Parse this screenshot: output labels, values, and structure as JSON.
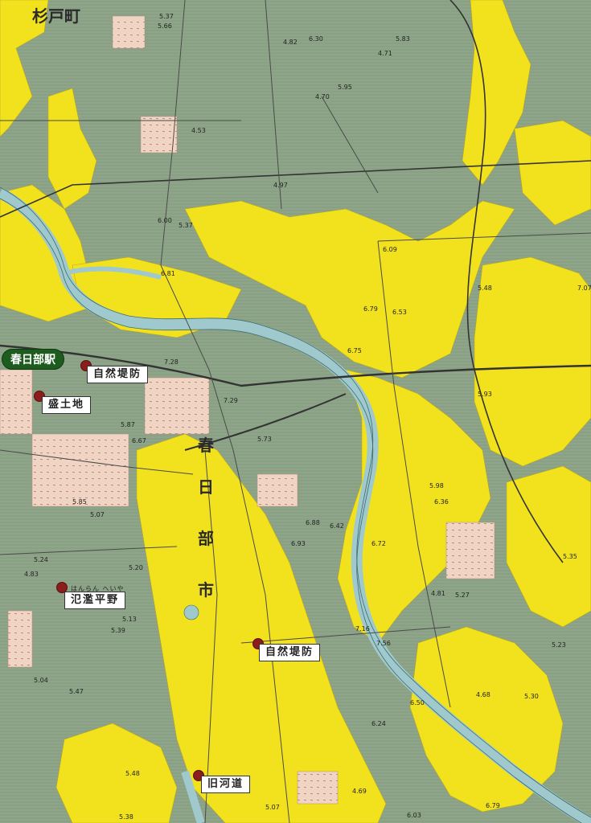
{
  "map": {
    "station": {
      "name": "春日部駅"
    },
    "town_label": "杉戸町",
    "city_label": [
      "春",
      "日",
      "部",
      "市"
    ],
    "annotations": [
      {
        "id": "natural-levee-1",
        "label": "自然堤防"
      },
      {
        "id": "fill-land",
        "label": "盛土地"
      },
      {
        "id": "flood-plain",
        "label": "氾濫平野",
        "reading": "はんらん へいや"
      },
      {
        "id": "natural-levee-2",
        "label": "自然堤防"
      },
      {
        "id": "old-river",
        "label": "旧河道"
      }
    ],
    "elevations": [
      "5.37",
      "5.66",
      "4.82",
      "6.30",
      "5.83",
      "4.71",
      "5.95",
      "4.70",
      "4.53",
      "4.97",
      "6.00",
      "5.37",
      "6.81",
      "6.09",
      "7.28",
      "7.29",
      "5.73",
      "5.87",
      "6.67",
      "5.85",
      "5.07",
      "5.24",
      "4.83",
      "5.20",
      "5.13",
      "5.39",
      "5.04",
      "5.47",
      "5.48",
      "5.38",
      "5.07",
      "6.79",
      "6.53",
      "6.75",
      "5.98",
      "6.36",
      "6.88",
      "6.42",
      "6.93",
      "6.72",
      "4.81",
      "5.27",
      "7.16",
      "7.56",
      "6.50",
      "6.24",
      "4.69",
      "6.03",
      "5.48",
      "5.93",
      "5.35",
      "5.23",
      "4.68",
      "5.30",
      "6.79",
      "7.07"
    ],
    "colors": {
      "lowland": "#8fa58a",
      "levee": "#f2e21e",
      "fill": "#f1d5c4",
      "river": "#9fc9cc",
      "marker": "#8b1d1d",
      "station": "#1e5b1e"
    }
  }
}
